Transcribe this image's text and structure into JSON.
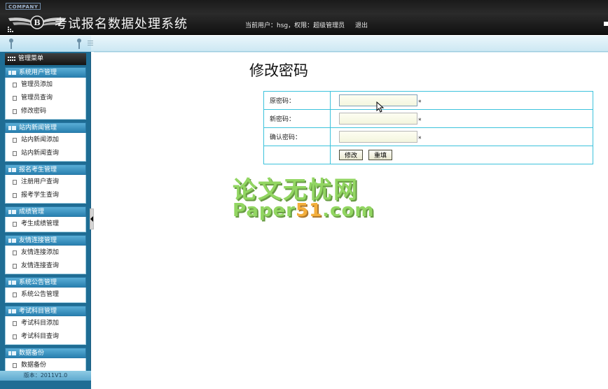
{
  "header": {
    "company": "COMPANY",
    "title": "考试报名数据处理系统",
    "user_info": "当前用户：hsg，权限：超级管理员",
    "logout": "退出"
  },
  "sidebar": {
    "menu_title": "管理菜单",
    "groups": [
      {
        "title": "系统用户管理",
        "items": [
          "管理员添加",
          "管理员查询",
          "修改密码"
        ]
      },
      {
        "title": "站内新闻管理",
        "items": [
          "站内新闻添加",
          "站内新闻查询"
        ]
      },
      {
        "title": "报名考生管理",
        "items": [
          "注册用户查询",
          "报考学生查询"
        ]
      },
      {
        "title": "成绩管理",
        "items": [
          "考生成绩管理"
        ]
      },
      {
        "title": "友情连接管理",
        "items": [
          "友情连接添加",
          "友情连接查询"
        ]
      },
      {
        "title": "系统公告管理",
        "items": [
          "系统公告管理"
        ]
      },
      {
        "title": "考试科目管理",
        "items": [
          "考试科目添加",
          "考试科目查询"
        ]
      },
      {
        "title": "数据备份",
        "items": [
          "数据备份"
        ]
      }
    ],
    "version": "版本：2011V1.0"
  },
  "main": {
    "title": "修改密码",
    "fields": [
      {
        "label": "原密码：",
        "value": "",
        "required": "*"
      },
      {
        "label": "新密码：",
        "value": "",
        "required": "*"
      },
      {
        "label": "确认密码：",
        "value": "",
        "required": "*"
      }
    ],
    "submit_label": "修改",
    "reset_label": "重填"
  },
  "watermark": {
    "line1": "论文无忧网",
    "line2_a": "Paper",
    "line2_b": "51",
    "line2_c": ".com"
  }
}
